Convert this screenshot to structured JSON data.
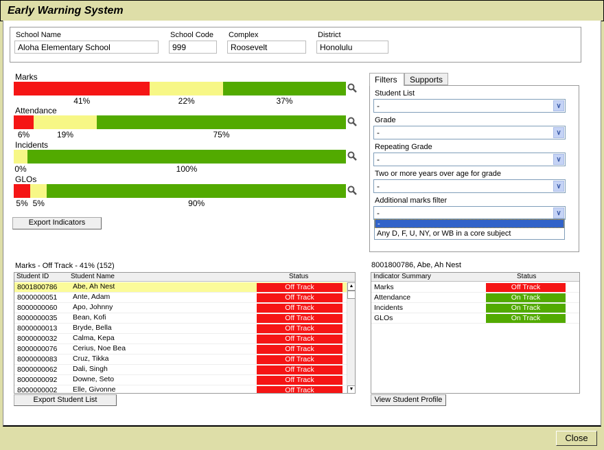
{
  "title": "Early Warning System",
  "school": {
    "name_label": "School Name",
    "name": "Aloha Elementary School",
    "code_label": "School Code",
    "code": "999",
    "complex_label": "Complex",
    "complex": "Roosevelt",
    "district_label": "District",
    "district": "Honolulu"
  },
  "colors": {
    "off_track": "#f51515",
    "at_risk": "#f7f786",
    "on_track": "#52aa00"
  },
  "indicators": [
    {
      "label": "Marks",
      "red": 41,
      "yellow": 22,
      "green": 37,
      "red_text": "41%",
      "yellow_text": "22%",
      "green_text": "37%"
    },
    {
      "label": "Attendance",
      "red": 6,
      "yellow": 19,
      "green": 75,
      "red_text": "6%",
      "yellow_text": "19%",
      "green_text": "75%"
    },
    {
      "label": "Incidents",
      "red": 0,
      "yellow": 0,
      "green": 100,
      "red_text": "",
      "yellow_text": "0%",
      "green_text": "100%"
    },
    {
      "label": "GLOs",
      "red": 5,
      "yellow": 5,
      "green": 90,
      "red_text": "5%",
      "yellow_text": "5%",
      "green_text": "90%"
    }
  ],
  "export_indicators": "Export Indicators",
  "student_list": {
    "caption": "Marks - Off Track - 41% (152)",
    "headers": [
      "Student ID",
      "Student Name",
      "Status"
    ],
    "rows": [
      {
        "id": "8001800786",
        "name": "Abe, Ah Nest",
        "status": "Off Track"
      },
      {
        "id": "8000000051",
        "name": "Ante, Adam",
        "status": "Off Track"
      },
      {
        "id": "8000000060",
        "name": "Apo, Johnny",
        "status": "Off Track"
      },
      {
        "id": "8000000035",
        "name": "Bean, Kofi",
        "status": "Off Track"
      },
      {
        "id": "8000000013",
        "name": "Bryde, Bella",
        "status": "Off Track"
      },
      {
        "id": "8000000032",
        "name": "Calma, Kepa",
        "status": "Off Track"
      },
      {
        "id": "8000000076",
        "name": "Cerius, Noe Bea",
        "status": "Off Track"
      },
      {
        "id": "8000000083",
        "name": "Cruz, Tikka",
        "status": "Off Track"
      },
      {
        "id": "8000000062",
        "name": "Dali, Singh",
        "status": "Off Track"
      },
      {
        "id": "8000000092",
        "name": "Downe, Seto",
        "status": "Off Track"
      },
      {
        "id": "8000000002",
        "name": "Elle, Givonne",
        "status": "Off Track"
      }
    ],
    "export_label": "Export Student List"
  },
  "tabs": [
    "Filters",
    "Supports"
  ],
  "filters": [
    {
      "label": "Student List",
      "value": "-"
    },
    {
      "label": "Grade",
      "value": "-"
    },
    {
      "label": "Repeating Grade",
      "value": "-"
    },
    {
      "label": "Two or more years over age for grade",
      "value": "-"
    },
    {
      "label": "Additional marks filter",
      "value": "-"
    }
  ],
  "dropdown_options": [
    "-",
    "Any D, F, U, NY, or WB in a core subject"
  ],
  "student_summary": {
    "caption": "8001800786, Abe, Ah Nest",
    "headers": [
      "Indicator Summary",
      "Status"
    ],
    "rows": [
      {
        "label": "Marks",
        "status": "Off Track"
      },
      {
        "label": "Attendance",
        "status": "On Track"
      },
      {
        "label": "Incidents",
        "status": "On Track"
      },
      {
        "label": "GLOs",
        "status": "On Track"
      }
    ],
    "view_profile": "View Student Profile"
  },
  "close_label": "Close"
}
